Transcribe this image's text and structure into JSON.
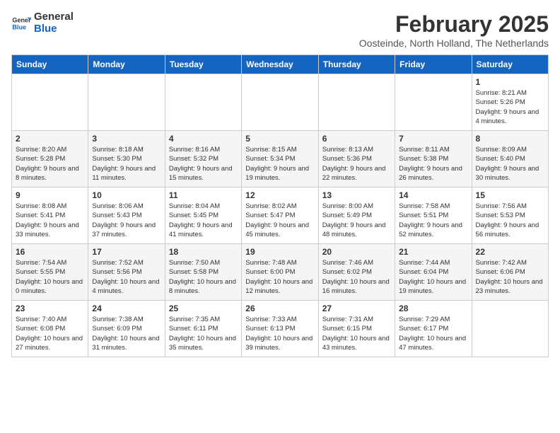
{
  "header": {
    "logo_line1": "General",
    "logo_line2": "Blue",
    "month": "February 2025",
    "location": "Oosteinde, North Holland, The Netherlands"
  },
  "weekdays": [
    "Sunday",
    "Monday",
    "Tuesday",
    "Wednesday",
    "Thursday",
    "Friday",
    "Saturday"
  ],
  "weeks": [
    [
      {
        "day": "",
        "info": ""
      },
      {
        "day": "",
        "info": ""
      },
      {
        "day": "",
        "info": ""
      },
      {
        "day": "",
        "info": ""
      },
      {
        "day": "",
        "info": ""
      },
      {
        "day": "",
        "info": ""
      },
      {
        "day": "1",
        "info": "Sunrise: 8:21 AM\nSunset: 5:26 PM\nDaylight: 9 hours and 4 minutes."
      }
    ],
    [
      {
        "day": "2",
        "info": "Sunrise: 8:20 AM\nSunset: 5:28 PM\nDaylight: 9 hours and 8 minutes."
      },
      {
        "day": "3",
        "info": "Sunrise: 8:18 AM\nSunset: 5:30 PM\nDaylight: 9 hours and 11 minutes."
      },
      {
        "day": "4",
        "info": "Sunrise: 8:16 AM\nSunset: 5:32 PM\nDaylight: 9 hours and 15 minutes."
      },
      {
        "day": "5",
        "info": "Sunrise: 8:15 AM\nSunset: 5:34 PM\nDaylight: 9 hours and 19 minutes."
      },
      {
        "day": "6",
        "info": "Sunrise: 8:13 AM\nSunset: 5:36 PM\nDaylight: 9 hours and 22 minutes."
      },
      {
        "day": "7",
        "info": "Sunrise: 8:11 AM\nSunset: 5:38 PM\nDaylight: 9 hours and 26 minutes."
      },
      {
        "day": "8",
        "info": "Sunrise: 8:09 AM\nSunset: 5:40 PM\nDaylight: 9 hours and 30 minutes."
      }
    ],
    [
      {
        "day": "9",
        "info": "Sunrise: 8:08 AM\nSunset: 5:41 PM\nDaylight: 9 hours and 33 minutes."
      },
      {
        "day": "10",
        "info": "Sunrise: 8:06 AM\nSunset: 5:43 PM\nDaylight: 9 hours and 37 minutes."
      },
      {
        "day": "11",
        "info": "Sunrise: 8:04 AM\nSunset: 5:45 PM\nDaylight: 9 hours and 41 minutes."
      },
      {
        "day": "12",
        "info": "Sunrise: 8:02 AM\nSunset: 5:47 PM\nDaylight: 9 hours and 45 minutes."
      },
      {
        "day": "13",
        "info": "Sunrise: 8:00 AM\nSunset: 5:49 PM\nDaylight: 9 hours and 48 minutes."
      },
      {
        "day": "14",
        "info": "Sunrise: 7:58 AM\nSunset: 5:51 PM\nDaylight: 9 hours and 52 minutes."
      },
      {
        "day": "15",
        "info": "Sunrise: 7:56 AM\nSunset: 5:53 PM\nDaylight: 9 hours and 56 minutes."
      }
    ],
    [
      {
        "day": "16",
        "info": "Sunrise: 7:54 AM\nSunset: 5:55 PM\nDaylight: 10 hours and 0 minutes."
      },
      {
        "day": "17",
        "info": "Sunrise: 7:52 AM\nSunset: 5:56 PM\nDaylight: 10 hours and 4 minutes."
      },
      {
        "day": "18",
        "info": "Sunrise: 7:50 AM\nSunset: 5:58 PM\nDaylight: 10 hours and 8 minutes."
      },
      {
        "day": "19",
        "info": "Sunrise: 7:48 AM\nSunset: 6:00 PM\nDaylight: 10 hours and 12 minutes."
      },
      {
        "day": "20",
        "info": "Sunrise: 7:46 AM\nSunset: 6:02 PM\nDaylight: 10 hours and 16 minutes."
      },
      {
        "day": "21",
        "info": "Sunrise: 7:44 AM\nSunset: 6:04 PM\nDaylight: 10 hours and 19 minutes."
      },
      {
        "day": "22",
        "info": "Sunrise: 7:42 AM\nSunset: 6:06 PM\nDaylight: 10 hours and 23 minutes."
      }
    ],
    [
      {
        "day": "23",
        "info": "Sunrise: 7:40 AM\nSunset: 6:08 PM\nDaylight: 10 hours and 27 minutes."
      },
      {
        "day": "24",
        "info": "Sunrise: 7:38 AM\nSunset: 6:09 PM\nDaylight: 10 hours and 31 minutes."
      },
      {
        "day": "25",
        "info": "Sunrise: 7:35 AM\nSunset: 6:11 PM\nDaylight: 10 hours and 35 minutes."
      },
      {
        "day": "26",
        "info": "Sunrise: 7:33 AM\nSunset: 6:13 PM\nDaylight: 10 hours and 39 minutes."
      },
      {
        "day": "27",
        "info": "Sunrise: 7:31 AM\nSunset: 6:15 PM\nDaylight: 10 hours and 43 minutes."
      },
      {
        "day": "28",
        "info": "Sunrise: 7:29 AM\nSunset: 6:17 PM\nDaylight: 10 hours and 47 minutes."
      },
      {
        "day": "",
        "info": ""
      }
    ]
  ]
}
